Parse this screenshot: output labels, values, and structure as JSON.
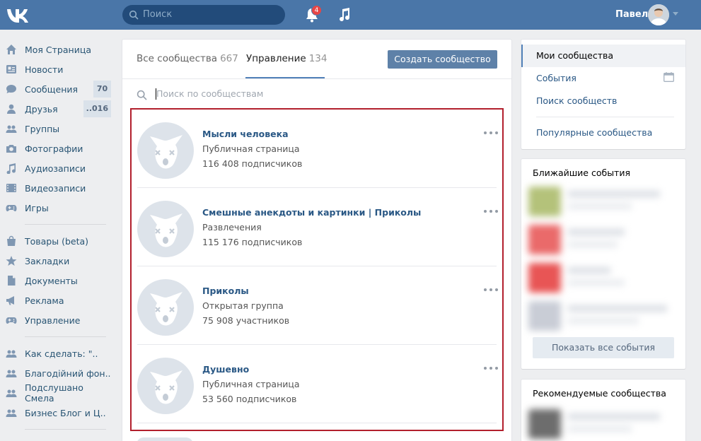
{
  "header": {
    "logo": "vk-logo",
    "search_placeholder": "Поиск",
    "notifications_count": "4",
    "user_name": "Павел"
  },
  "sidebar": {
    "group1": [
      {
        "label": "Моя Страница",
        "icon": "home-icon"
      },
      {
        "label": "Новости",
        "icon": "news-icon"
      },
      {
        "label": "Сообщения",
        "icon": "messages-icon",
        "count": "70"
      },
      {
        "label": "Друзья",
        "icon": "friends-icon",
        "count": "..016"
      },
      {
        "label": "Группы",
        "icon": "groups-icon"
      },
      {
        "label": "Фотографии",
        "icon": "camera-icon"
      },
      {
        "label": "Аудиозаписи",
        "icon": "music-icon"
      },
      {
        "label": "Видеозаписи",
        "icon": "video-icon"
      },
      {
        "label": "Игры",
        "icon": "gamepad-icon"
      }
    ],
    "group2": [
      {
        "label": "Товары (beta)",
        "icon": "bag-icon"
      },
      {
        "label": "Закладки",
        "icon": "star-icon"
      },
      {
        "label": "Документы",
        "icon": "document-icon"
      },
      {
        "label": "Реклама",
        "icon": "megaphone-icon"
      },
      {
        "label": "Управление",
        "icon": "gamepad-icon"
      }
    ],
    "group3": [
      {
        "label": "Как сделать: \"..",
        "icon": "groups-icon"
      },
      {
        "label": "Благодiйний фон..",
        "icon": "groups-icon"
      },
      {
        "label": "Подслушано Смела",
        "icon": "groups-icon"
      },
      {
        "label": "Бизнес Блог и Ц..",
        "icon": "groups-icon"
      }
    ]
  },
  "main": {
    "tabs": [
      {
        "label": "Все сообщества",
        "count": "667"
      },
      {
        "label": "Управление",
        "count": "134"
      }
    ],
    "create_button": "Создать сообщество",
    "search_placeholder": "Поиск по сообществам",
    "communities": [
      {
        "name": "Мысли человека",
        "type": "Публичная страница",
        "subscribers": "116 408 подписчиков"
      },
      {
        "name": "Смешные анекдоты и картинки | Приколы",
        "type": "Развлечения",
        "subscribers": "115 176 подписчиков"
      },
      {
        "name": "Приколы",
        "type": "Открытая группа",
        "subscribers": "75 908 участников"
      },
      {
        "name": "Душевно",
        "type": "Публичная страница",
        "subscribers": "53 560 подписчиков"
      }
    ]
  },
  "right_menu": {
    "items": [
      "Мои сообщества",
      "События",
      "Поиск сообществ",
      "Популярные сообщества"
    ]
  },
  "events": {
    "title": "Ближайшие события",
    "show_all": "Показать все события"
  },
  "recommended": {
    "title": "Рекомендуемые сообщества"
  },
  "colors": {
    "header": "#4a76a8",
    "link": "#2a5885",
    "highlight_border": "#b21f2d",
    "button": "#5e81a8"
  }
}
